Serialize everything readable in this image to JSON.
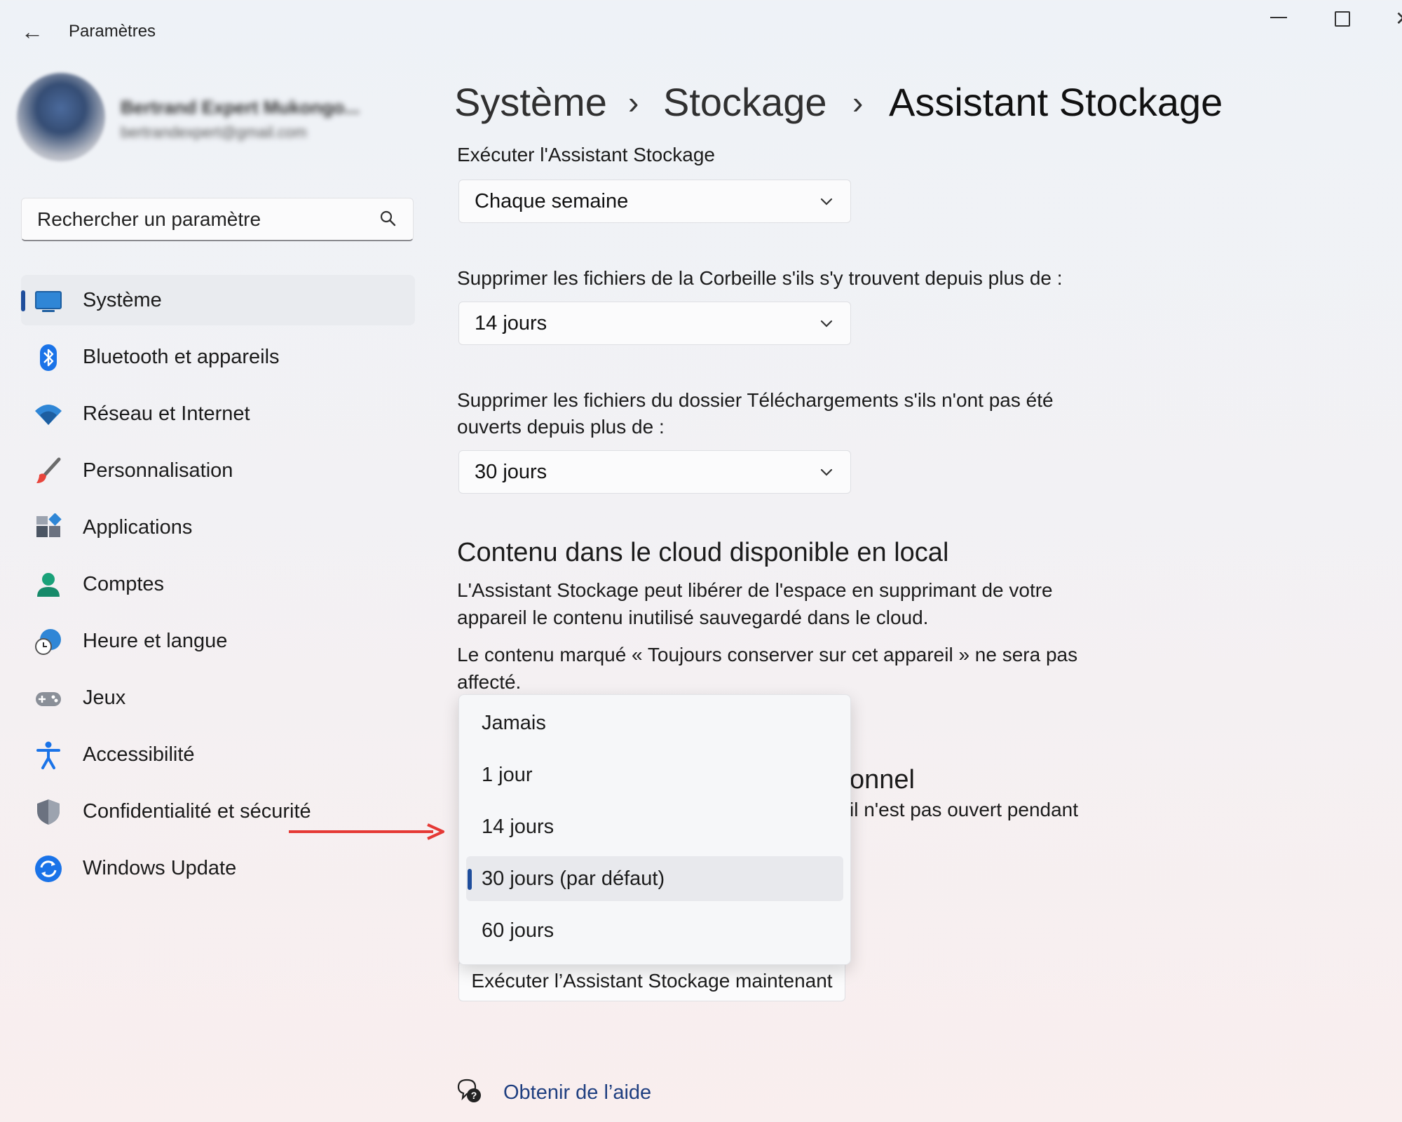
{
  "titlebar": {
    "back_glyph": "←",
    "title": "Paramètres",
    "minimize_icon": "minimize-icon",
    "maximize_icon": "maximize-icon",
    "close_glyph": "✕"
  },
  "profile": {
    "name": "Bertrand Expert Mukongo...",
    "email": "bertrandexpert@gmail.com"
  },
  "search": {
    "placeholder": "Rechercher un paramètre",
    "icon": "search-icon"
  },
  "sidebar": {
    "items": [
      {
        "label": "Système",
        "icon": "system-display-icon",
        "selected": true
      },
      {
        "label": "Bluetooth et appareils",
        "icon": "bluetooth-icon"
      },
      {
        "label": "Réseau et Internet",
        "icon": "wifi-icon"
      },
      {
        "label": "Personnalisation",
        "icon": "paintbrush-icon"
      },
      {
        "label": "Applications",
        "icon": "apps-icon"
      },
      {
        "label": "Comptes",
        "icon": "account-icon"
      },
      {
        "label": "Heure et langue",
        "icon": "clock-globe-icon"
      },
      {
        "label": "Jeux",
        "icon": "gamepad-icon"
      },
      {
        "label": "Accessibilité",
        "icon": "accessibility-icon"
      },
      {
        "label": "Confidentialité et sécurité",
        "icon": "shield-icon"
      },
      {
        "label": "Windows Update",
        "icon": "update-icon"
      }
    ]
  },
  "breadcrumb": {
    "items": [
      "Système",
      "Stockage",
      "Assistant Stockage"
    ],
    "separator": "›"
  },
  "content": {
    "run_label": "Exécuter l'Assistant Stockage",
    "run_value": "Chaque semaine",
    "recycle_label": "Supprimer les fichiers de la Corbeille s'ils s'y trouvent depuis plus de :",
    "recycle_value": "14 jours",
    "downloads_label_line1": "Supprimer les fichiers du dossier Téléchargements s'ils n'ont pas été",
    "downloads_label_line2": "ouverts depuis plus de :",
    "downloads_value": "30 jours",
    "cloud_title": "Contenu dans le cloud disponible en local",
    "cloud_para1": "L'Assistant Stockage peut libérer de l'espace en supprimant de votre appareil le contenu inutilisé sauvegardé dans le cloud.",
    "cloud_para2": "Le contenu marqué « Toujours conserver sur cet appareil » ne sera pas affecté.",
    "partial_title": "onnel",
    "partial_text": "il n'est pas ouvert pendant",
    "run_now_button": "Exécuter l’Assistant Stockage maintenant"
  },
  "popup": {
    "options": [
      "Jamais",
      "1 jour",
      "14 jours",
      "30 jours (par défaut)",
      "60 jours"
    ],
    "selected_index": 3
  },
  "help": {
    "label": "Obtenir de l’aide",
    "icon": "help-icon"
  },
  "colors": {
    "accent": "#1f4e9c",
    "annotation_arrow": "#e53935"
  }
}
